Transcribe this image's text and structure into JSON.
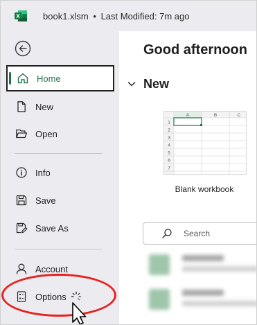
{
  "titlebar": {
    "app_icon": "excel-icon",
    "file_name": "book1.xlsm",
    "separator": "•",
    "modified": "Last Modified: 7m ago"
  },
  "sidebar": {
    "back_icon": "back-arrow-icon",
    "items": [
      {
        "label": "Home",
        "icon": "home-icon",
        "active": true
      },
      {
        "label": "New",
        "icon": "new-document-icon"
      },
      {
        "label": "Open",
        "icon": "folder-open-icon"
      },
      {
        "label": "Info",
        "icon": "info-icon"
      },
      {
        "label": "Save",
        "icon": "save-icon"
      },
      {
        "label": "Save As",
        "icon": "save-as-icon"
      },
      {
        "label": "Account",
        "icon": "person-icon"
      },
      {
        "label": "Options",
        "icon": "options-icon"
      }
    ]
  },
  "main": {
    "greeting": "Good afternoon",
    "new_section": {
      "label": "New",
      "template": {
        "label": "Blank workbook",
        "columns": [
          "A",
          "B",
          "C"
        ],
        "rows": [
          "1",
          "2",
          "3",
          "4",
          "5",
          "6",
          "7"
        ]
      }
    },
    "search": {
      "placeholder": "Search",
      "icon": "search-icon"
    }
  },
  "colors": {
    "accent": "#217346",
    "sidebar_bg": "#ececf0",
    "annotation": "#e8201f"
  }
}
